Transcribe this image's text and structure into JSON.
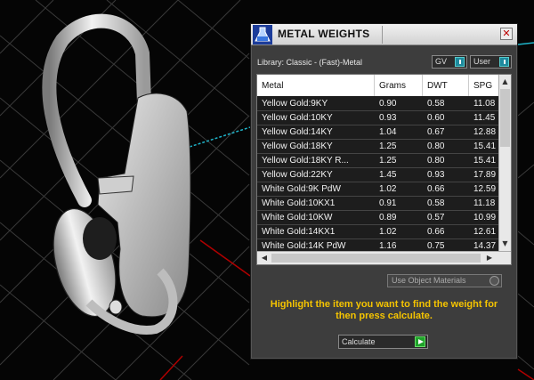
{
  "panel": {
    "title": "METAL WEIGHTS",
    "close_label": "✕",
    "library_label": "Library: Classic - (Fast)-Metal",
    "gv_label": "GV",
    "user_label": "User",
    "use_object_materials_label": "Use Object Materials",
    "hint": "Highlight the item you want to find the weight for then press calculate.",
    "calculate_label": "Calculate"
  },
  "table": {
    "columns": [
      "Metal",
      "Grams",
      "DWT",
      "SPG"
    ],
    "rows": [
      [
        "Yellow Gold:9KY",
        "0.90",
        "0.58",
        "11.08"
      ],
      [
        "Yellow Gold:10KY",
        "0.93",
        "0.60",
        "11.45"
      ],
      [
        "Yellow Gold:14KY",
        "1.04",
        "0.67",
        "12.88"
      ],
      [
        "Yellow Gold:18KY",
        "1.25",
        "0.80",
        "15.41"
      ],
      [
        "Yellow Gold:18KY R...",
        "1.25",
        "0.80",
        "15.41"
      ],
      [
        "Yellow Gold:22KY",
        "1.45",
        "0.93",
        "17.89"
      ],
      [
        "White Gold:9K PdW",
        "1.02",
        "0.66",
        "12.59"
      ],
      [
        "White Gold:10KX1",
        "0.91",
        "0.58",
        "11.18"
      ],
      [
        "White Gold:10KW",
        "0.89",
        "0.57",
        "10.99"
      ],
      [
        "White Gold:14KX1",
        "1.02",
        "0.66",
        "12.61"
      ],
      [
        "White Gold:14K PdW",
        "1.16",
        "0.75",
        "14.37"
      ]
    ]
  },
  "colors": {
    "hint_text": "#f5c400",
    "viewport_bg": "#050505",
    "axis_red": "#b00000",
    "axis_cyan": "#1fb3c8",
    "toggle_accent": "#1e8a9e",
    "go_green": "#1fa22a"
  }
}
